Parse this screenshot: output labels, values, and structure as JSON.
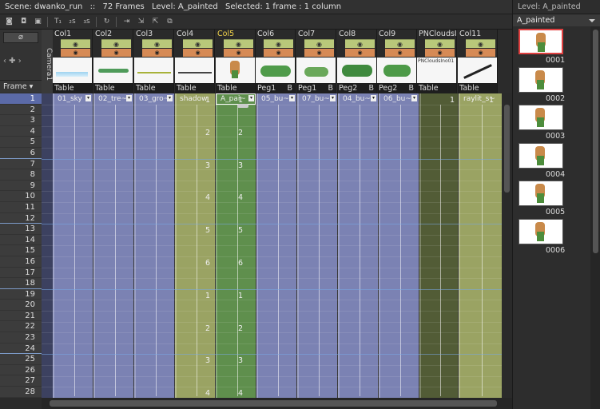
{
  "topbar": {
    "scene": "Scene: dwanko_run",
    "sep": "::",
    "frames": "72 Frames",
    "level": "Level: A_painted",
    "selected": "Selected: 1 frame : 1 column"
  },
  "camera_label": "Camera1",
  "frame_header": "Frame",
  "columns": [
    {
      "name": "Col1",
      "footer": "Table",
      "foot_b": "",
      "cell_label": "01_sky"
    },
    {
      "name": "Col2",
      "footer": "Table",
      "foot_b": "",
      "cell_label": "02_tre~"
    },
    {
      "name": "Col3",
      "footer": "Table",
      "foot_b": "",
      "cell_label": "03_gro~"
    },
    {
      "name": "Col4",
      "footer": "Table",
      "foot_b": "",
      "cell_label": "shadow"
    },
    {
      "name": "Col5",
      "footer": "Table",
      "foot_b": "",
      "cell_label": "A_pai~"
    },
    {
      "name": "Col6",
      "footer": "Peg1",
      "foot_b": "B",
      "cell_label": "05_bu~"
    },
    {
      "name": "Col7",
      "footer": "Peg1",
      "foot_b": "B",
      "cell_label": "07_bu~"
    },
    {
      "name": "Col8",
      "footer": "Peg2",
      "foot_b": "B",
      "cell_label": "04_bu~"
    },
    {
      "name": "Col9",
      "footer": "Peg2",
      "foot_b": "B",
      "cell_label": "06_bu~"
    },
    {
      "name": "PNCloudsIn",
      "footer": "Table",
      "foot_b": "",
      "cell_label": "",
      "thumb_text": "PNCloudsIno01"
    },
    {
      "name": "Col11",
      "footer": "Table",
      "foot_b": "",
      "cell_label": "raylit_s~"
    }
  ],
  "frames": [
    "1",
    "2",
    "3",
    "4",
    "5",
    "6",
    "7",
    "8",
    "9",
    "10",
    "11",
    "12",
    "13",
    "14",
    "15",
    "16",
    "17",
    "18",
    "19",
    "20",
    "21",
    "22",
    "23",
    "24",
    "25",
    "26",
    "27",
    "28"
  ],
  "col4_numbers": [
    "1",
    "2",
    "3",
    "4",
    "5",
    "6",
    "1",
    "2",
    "3",
    "4"
  ],
  "col5_numbers": [
    "1",
    "2",
    "3",
    "4",
    "5",
    "6",
    "1",
    "2",
    "3",
    "4"
  ],
  "pncloud_number": "1",
  "raylit_number": "1",
  "level_panel": {
    "title": "Level:  A_painted",
    "dropdown": "A_painted",
    "thumbs": [
      "0001",
      "0002",
      "0003",
      "0004",
      "0005",
      "0006"
    ]
  },
  "colors": {
    "blue_cell": "#7b82b3",
    "yellow_cell": "#9aa363",
    "green_cell": "#5f8f4d",
    "dark_olive": "#525c36",
    "selected_frame": "#5b6aa7"
  }
}
